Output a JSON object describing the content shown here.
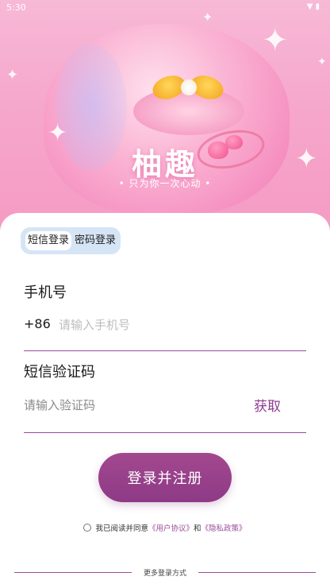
{
  "status": {
    "time": "5:30",
    "icons": [
      "wifi-icon",
      "battery-icon"
    ]
  },
  "hero": {
    "title": "柚趣",
    "slogan": "• 只为你一次心动 •"
  },
  "tabs": {
    "sms": "短信登录",
    "password": "密码登录",
    "selected": "sms"
  },
  "phone": {
    "label": "手机号",
    "prefix": "+86",
    "placeholder": "请输入手机号",
    "value": ""
  },
  "code": {
    "label": "短信验证码",
    "placeholder": "请输入验证码",
    "value": "",
    "get_label": "获取"
  },
  "submit_label": "登录并注册",
  "agreement": {
    "checked": false,
    "prefix": "我已阅读并同意",
    "user_agreement": "《用户协议》",
    "and": "和",
    "privacy_policy": "《隐私政策》"
  },
  "more_login": "更多登录方式",
  "colors": {
    "accent": "#8e3a86",
    "hero_pink": "#f6a7cc",
    "tab_bg": "#d5e5f5"
  }
}
